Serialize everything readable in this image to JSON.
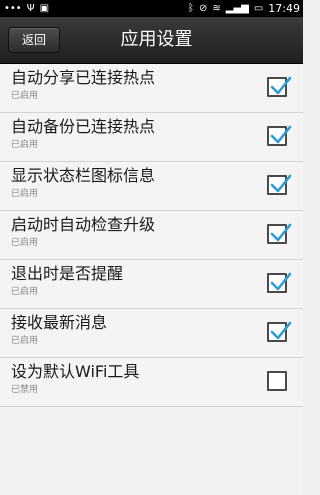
{
  "status_bar": {
    "time": "17:49",
    "left_icons": [
      "more-icon",
      "usb-icon",
      "notification-icon"
    ],
    "right_icons": [
      "bluetooth-icon",
      "silent-icon",
      "wifi-icon",
      "signal-icon",
      "battery-icon"
    ]
  },
  "header": {
    "back_label": "返回",
    "title": "应用设置"
  },
  "settings": [
    {
      "title": "自动分享已连接热点",
      "status": "已启用",
      "checked": true
    },
    {
      "title": "自动备份已连接热点",
      "status": "已启用",
      "checked": true
    },
    {
      "title": "显示状态栏图标信息",
      "status": "已启用",
      "checked": true
    },
    {
      "title": "启动时自动检查升级",
      "status": "已启用",
      "checked": true
    },
    {
      "title": "退出时是否提醒",
      "status": "已启用",
      "checked": true
    },
    {
      "title": "接收最新消息",
      "status": "已启用",
      "checked": true
    },
    {
      "title": "设为默认WiFi工具",
      "status": "已禁用",
      "checked": false
    }
  ],
  "colors": {
    "checkmark": "#2e9bd6",
    "title_bar": "#2a2a2a",
    "background": "#f2f2f2"
  }
}
